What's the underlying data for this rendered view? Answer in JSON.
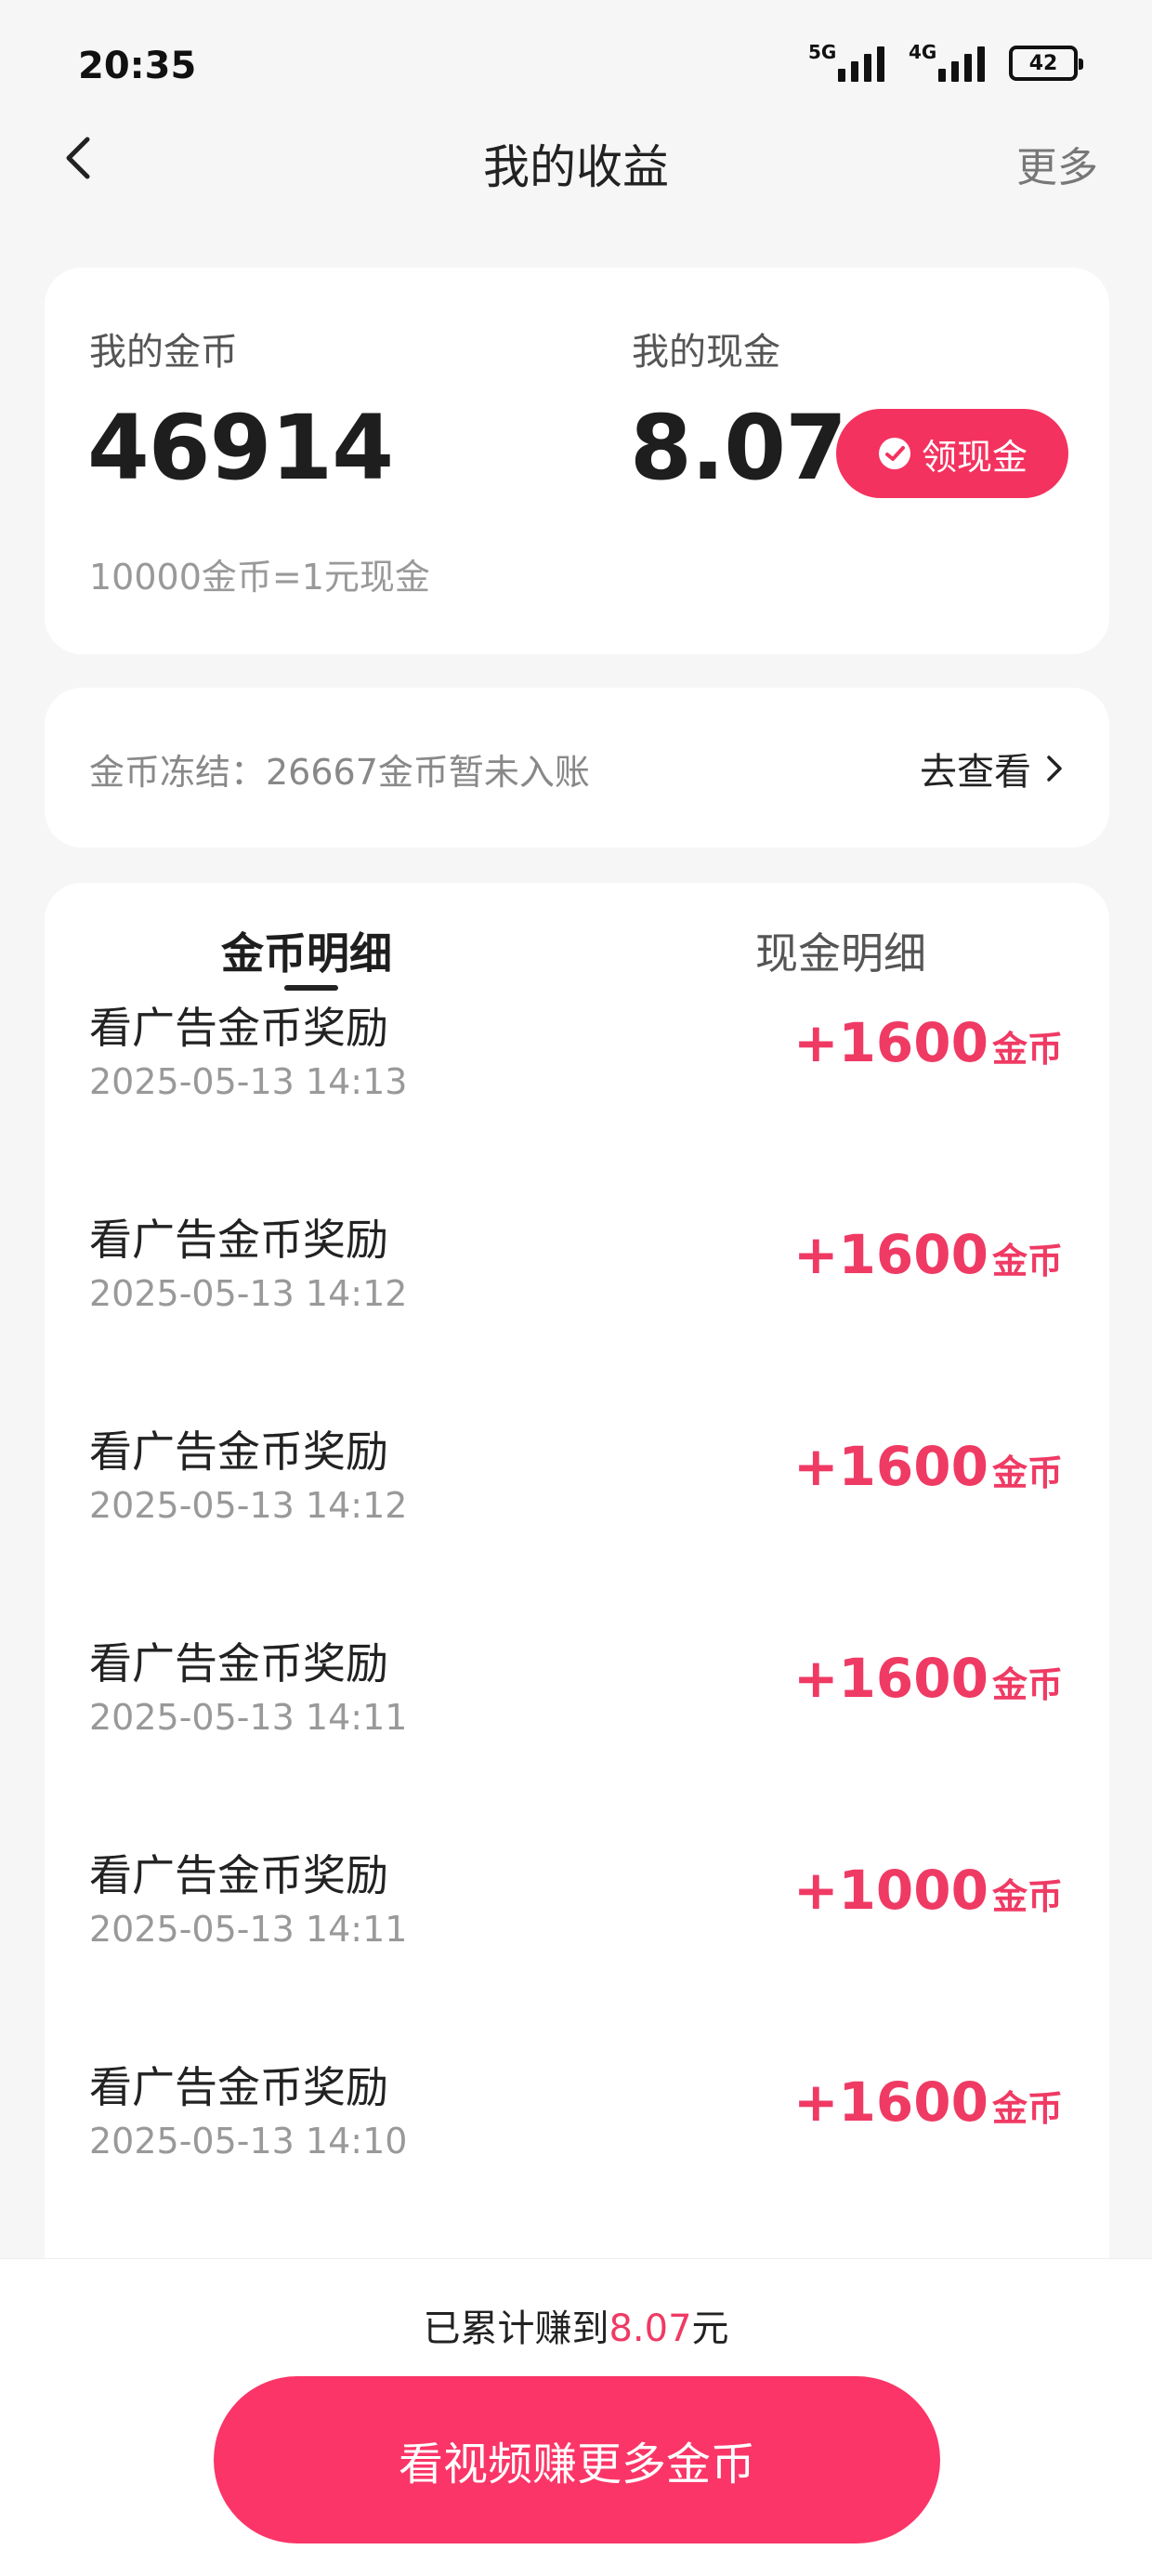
{
  "status_bar": {
    "time": "20:35",
    "signal1_label": "5G",
    "signal2_label": "4G",
    "battery": "42"
  },
  "header": {
    "title": "我的收益",
    "more": "更多"
  },
  "summary": {
    "coins_label": "我的金币",
    "coins_value": "46914",
    "cash_label": "我的现金",
    "cash_value": "8.07",
    "cash_button": "领现金",
    "rate": "10000金币=1元现金"
  },
  "frozen": {
    "text": "金币冻结：26667金币暂未入账",
    "link": "去查看"
  },
  "tabs": {
    "coins": "金币明细",
    "cash": "现金明细"
  },
  "records": [
    {
      "title": "看广告金币奖励",
      "time": "2025-05-13 14:13",
      "amount": "+1600",
      "unit": "金币"
    },
    {
      "title": "看广告金币奖励",
      "time": "2025-05-13 14:12",
      "amount": "+1600",
      "unit": "金币"
    },
    {
      "title": "看广告金币奖励",
      "time": "2025-05-13 14:12",
      "amount": "+1600",
      "unit": "金币"
    },
    {
      "title": "看广告金币奖励",
      "time": "2025-05-13 14:11",
      "amount": "+1600",
      "unit": "金币"
    },
    {
      "title": "看广告金币奖励",
      "time": "2025-05-13 14:11",
      "amount": "+1000",
      "unit": "金币"
    },
    {
      "title": "看广告金币奖励",
      "time": "2025-05-13 14:10",
      "amount": "+1600",
      "unit": "金币"
    }
  ],
  "footer": {
    "earned_prefix": "已累计赚到",
    "earned_value": "8.07",
    "earned_suffix": "元",
    "cta": "看视频赚更多金币"
  },
  "colors": {
    "accent": "#ef3a64",
    "button": "#fb3567"
  }
}
